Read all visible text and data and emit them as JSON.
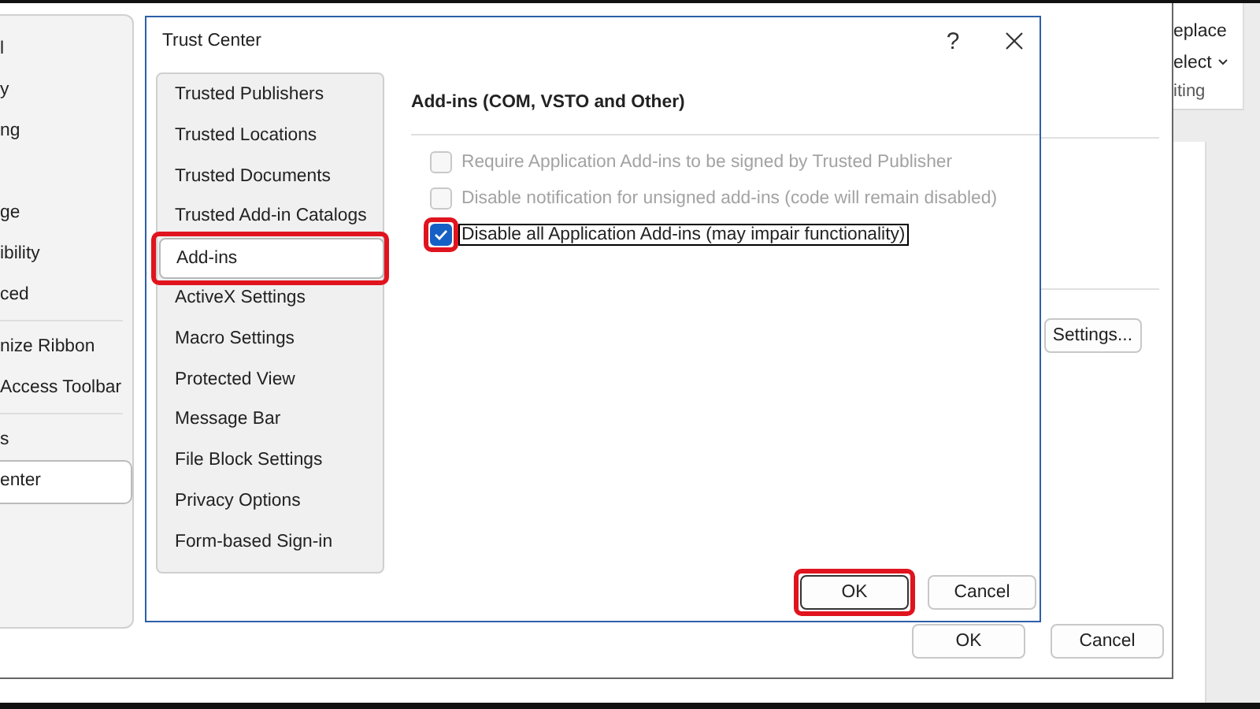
{
  "options_window": {
    "nav_groups": [
      [
        {
          "label": "l",
          "selected": false
        },
        {
          "label": "y",
          "selected": false
        },
        {
          "label": "ng",
          "selected": false
        }
      ],
      [
        {
          "label": "ge",
          "selected": false
        },
        {
          "label": "ibility",
          "selected": false
        },
        {
          "label": "ced",
          "selected": false
        }
      ],
      [
        {
          "label": "nize Ribbon",
          "selected": false
        },
        {
          "label": "Access Toolbar",
          "selected": false
        }
      ],
      [
        {
          "label": "s",
          "selected": false
        },
        {
          "label": "enter",
          "selected": true
        }
      ]
    ],
    "settings_button": "Settings...",
    "buttons": [
      {
        "label": "OK"
      },
      {
        "label": "Cancel"
      }
    ]
  },
  "ribbon": {
    "items": [
      "eplace",
      "elect",
      "iting"
    ]
  },
  "dialog": {
    "title": "Trust Center",
    "help": "?",
    "nav": [
      {
        "label": "Trusted Publishers",
        "selected": false,
        "highlighted": false
      },
      {
        "label": "Trusted Locations",
        "selected": false,
        "highlighted": false
      },
      {
        "label": "Trusted Documents",
        "selected": false,
        "highlighted": false
      },
      {
        "label": "Trusted Add-in Catalogs",
        "selected": false,
        "highlighted": false
      },
      {
        "label": "Add-ins",
        "selected": true,
        "highlighted": true
      },
      {
        "label": "ActiveX Settings",
        "selected": false,
        "highlighted": false
      },
      {
        "label": "Macro Settings",
        "selected": false,
        "highlighted": false
      },
      {
        "label": "Protected View",
        "selected": false,
        "highlighted": false
      },
      {
        "label": "Message Bar",
        "selected": false,
        "highlighted": false
      },
      {
        "label": "File Block Settings",
        "selected": false,
        "highlighted": false
      },
      {
        "label": "Privacy Options",
        "selected": false,
        "highlighted": false
      },
      {
        "label": "Form-based Sign-in",
        "selected": false,
        "highlighted": false
      }
    ],
    "heading": "Add-ins (COM, VSTO and Other)",
    "options": [
      {
        "label": "Require Application Add-ins to be signed by Trusted Publisher",
        "checked": false,
        "disabled": true,
        "focused": false,
        "highlighted": false
      },
      {
        "label": "Disable notification for unsigned add-ins (code will remain disabled)",
        "checked": false,
        "disabled": true,
        "focused": false,
        "highlighted": false
      },
      {
        "label": "Disable all Application Add-ins (may impair functionality)",
        "checked": true,
        "disabled": false,
        "focused": true,
        "highlighted": true
      }
    ],
    "buttons": [
      {
        "label": "OK",
        "default": true,
        "highlighted": true
      },
      {
        "label": "Cancel",
        "default": false,
        "highlighted": false
      }
    ]
  }
}
